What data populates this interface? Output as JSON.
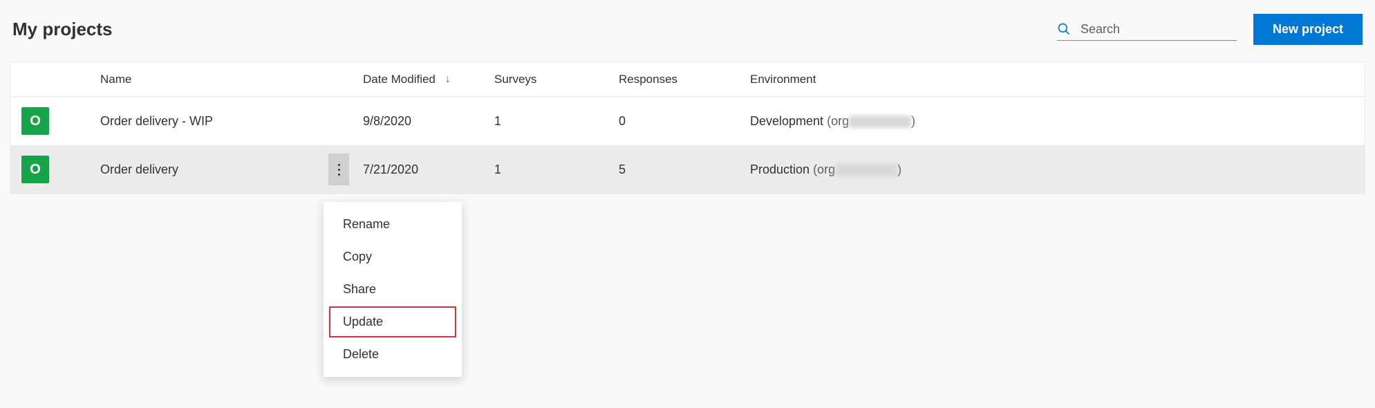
{
  "header": {
    "title": "My projects",
    "search_placeholder": "Search",
    "new_project_label": "New project"
  },
  "table": {
    "columns": {
      "name": "Name",
      "date_modified": "Date Modified",
      "surveys": "Surveys",
      "responses": "Responses",
      "environment": "Environment"
    },
    "sort_indicator": "↓",
    "rows": [
      {
        "badge": "O",
        "name": "Order delivery - WIP",
        "date_modified": "9/8/2020",
        "surveys": "1",
        "responses": "0",
        "environment": "Development",
        "org_prefix": "(org",
        "org_suffix": ")",
        "selected": false,
        "show_more": false
      },
      {
        "badge": "O",
        "name": "Order delivery",
        "date_modified": "7/21/2020",
        "surveys": "1",
        "responses": "5",
        "environment": "Production",
        "org_prefix": " (org",
        "org_suffix": ")",
        "selected": true,
        "show_more": true
      }
    ]
  },
  "context_menu": {
    "items": [
      {
        "label": "Rename",
        "highlight": false
      },
      {
        "label": "Copy",
        "highlight": false
      },
      {
        "label": "Share",
        "highlight": false
      },
      {
        "label": "Update",
        "highlight": true
      },
      {
        "label": "Delete",
        "highlight": false
      }
    ]
  }
}
